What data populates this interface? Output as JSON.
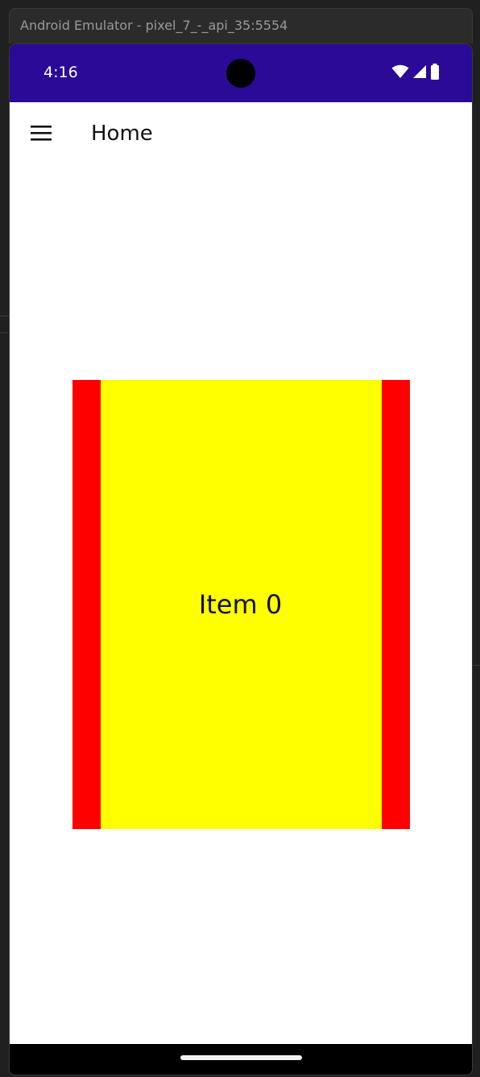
{
  "window": {
    "title": "Android Emulator - pixel_7_-_api_35:5554"
  },
  "status_bar": {
    "time": "4:16",
    "background": "#2a0a96",
    "icons": [
      "wifi-icon",
      "cellular-signal-icon",
      "battery-icon"
    ]
  },
  "app_bar": {
    "menu_icon": "hamburger-menu-icon",
    "title": "Home"
  },
  "carousel": {
    "item_label": "Item 0",
    "item_background": "#ffff00",
    "frame_color": "#ff0000"
  },
  "nav_bar": {
    "gesture": "home-indicator"
  }
}
